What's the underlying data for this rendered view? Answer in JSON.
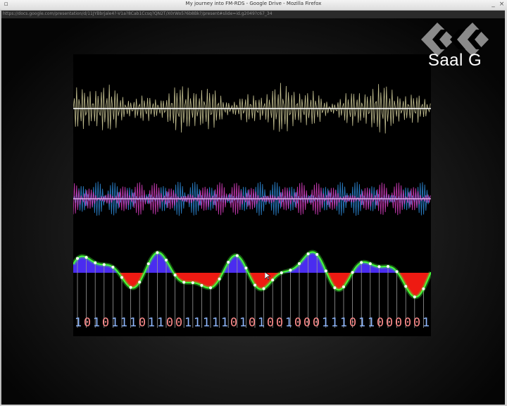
{
  "window": {
    "title": "My journey into FM-RDS - Google Drive - Mozilla Firefox",
    "url": "https://docs.google.com/presentation/d/11JYBbrjale4?-V1a?8Cab1Ccsq?QN2T/X0rWo5?6b8Bk?/present#slide=id.g2049?c67_34"
  },
  "brand": {
    "name": "Saal G",
    "logo_icon": "ccc-logo-icon"
  },
  "slide": {
    "bits": [
      "1",
      "0",
      "1",
      "0",
      "1",
      "1",
      "1",
      "0",
      "1",
      "1",
      "0",
      "0",
      "1",
      "1",
      "1",
      "1",
      "1",
      "0",
      "1",
      "0",
      "1",
      "0",
      "0",
      "1",
      "0",
      "0",
      "0",
      "1",
      "1",
      "1",
      "0",
      "1",
      "1",
      "0",
      "0",
      "0",
      "0",
      "0",
      "1"
    ],
    "colors": {
      "wave1": "#d8d4a0",
      "wave2_a": "#2f8fe0",
      "wave2_b": "#e040c8",
      "signal": "#46ff3a",
      "positive": "#4a2cf0",
      "negative": "#ee1a12",
      "bit_one": "#8fb8ff",
      "bit_zero": "#ff8c8c"
    }
  }
}
